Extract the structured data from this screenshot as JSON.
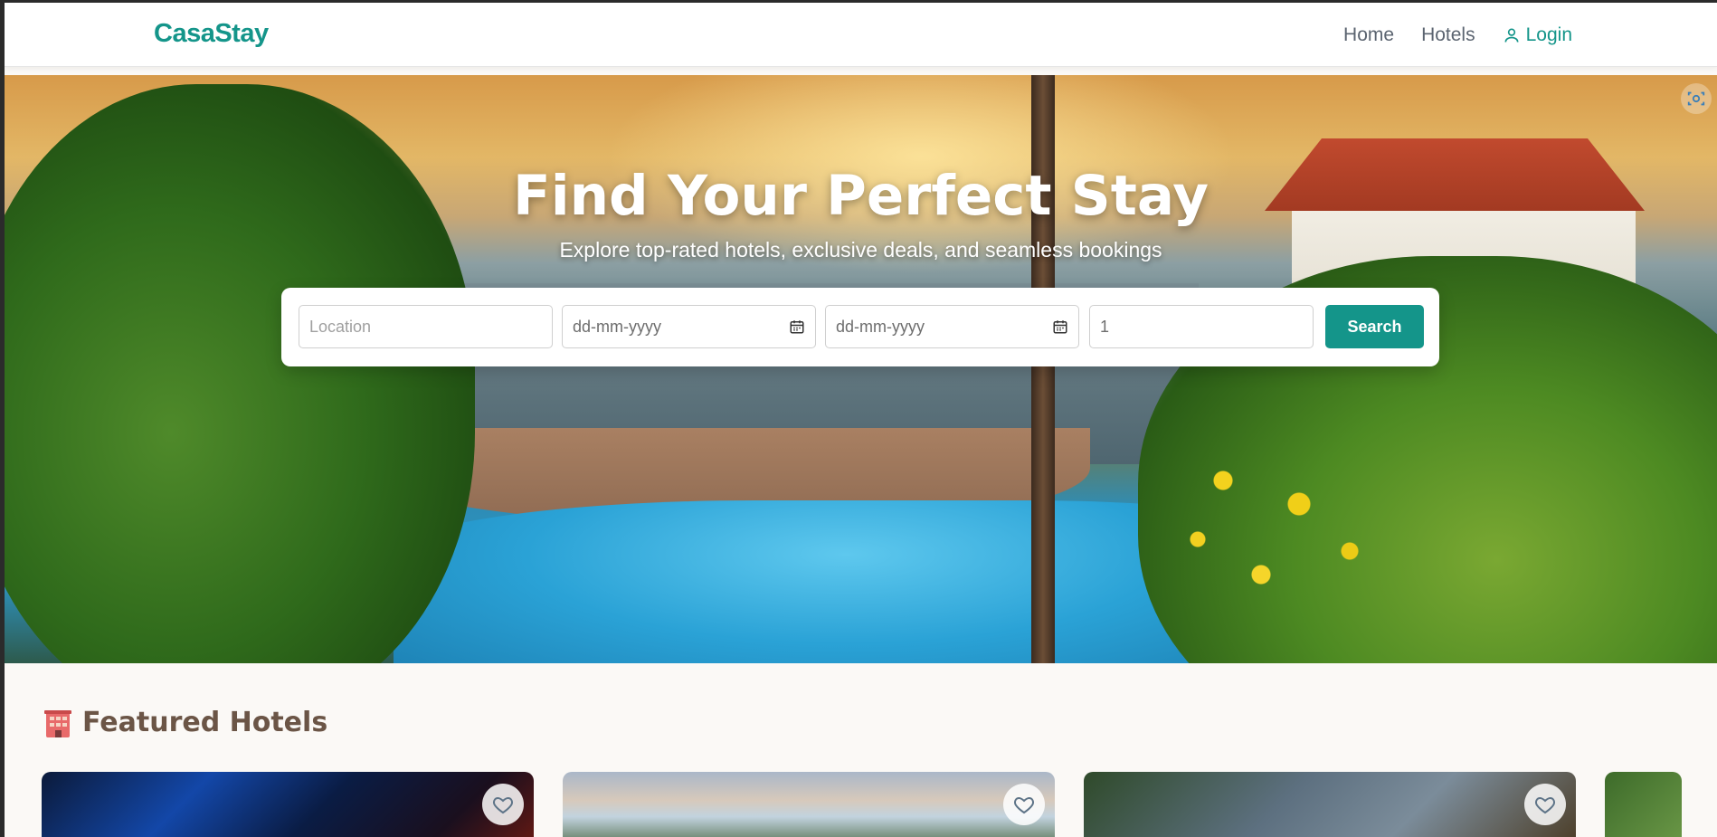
{
  "header": {
    "brand": "CasaStay",
    "nav": {
      "home": "Home",
      "hotels": "Hotels",
      "login": "Login"
    }
  },
  "hero": {
    "title": "Find Your Perfect Stay",
    "subtitle": "Explore top-rated hotels, exclusive deals, and seamless bookings"
  },
  "search": {
    "location_placeholder": "Location",
    "checkin_placeholder": "dd-mm-yyyy",
    "checkout_placeholder": "dd-mm-yyyy",
    "guests_value": "1",
    "button_label": "Search"
  },
  "featured": {
    "title": "Featured Hotels",
    "icon": "hotel-icon"
  },
  "colors": {
    "accent": "#14958a",
    "heading": "#6b5546",
    "nav_text": "#5b6470"
  }
}
